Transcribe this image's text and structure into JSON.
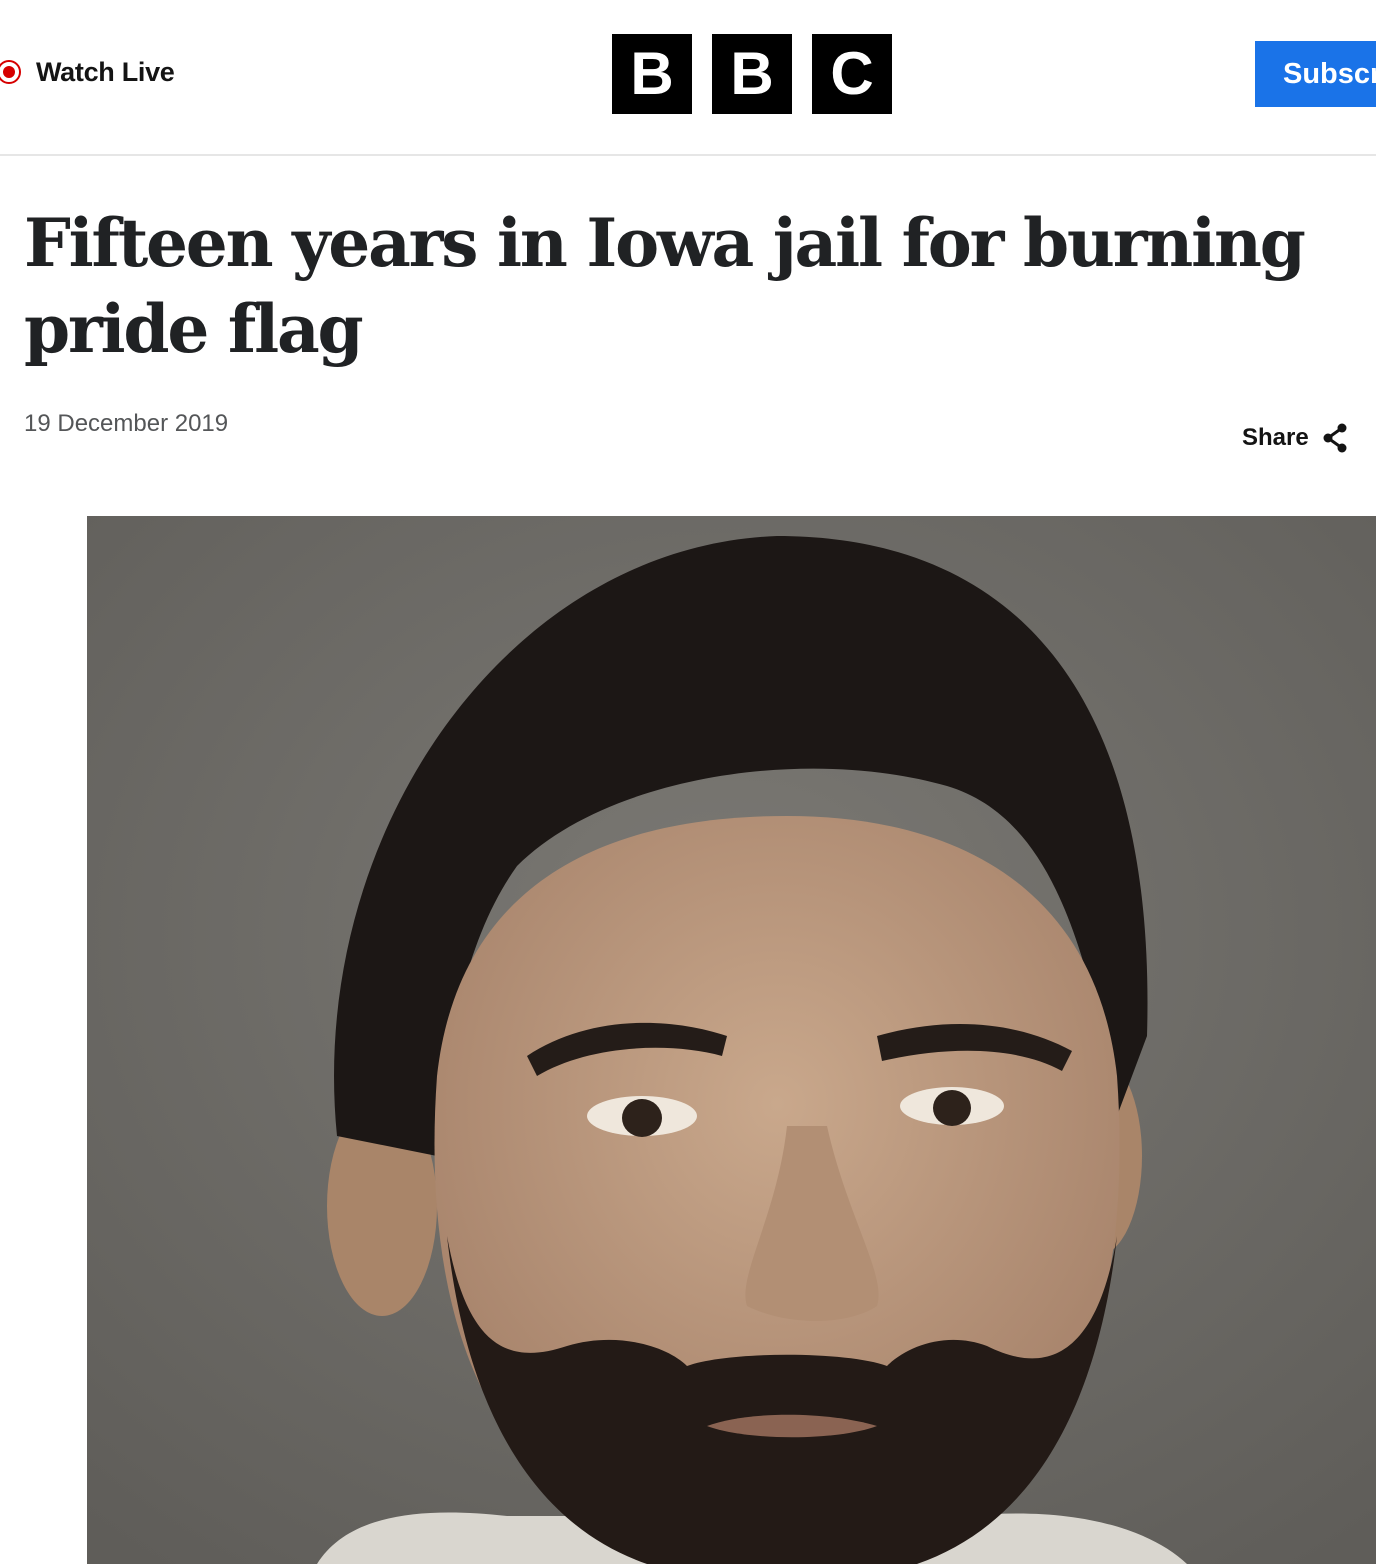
{
  "header": {
    "watch_live_label": "Watch Live",
    "logo_letters": [
      "B",
      "B",
      "C"
    ],
    "subscribe_label": "Subscr"
  },
  "article": {
    "headline": "Fifteen years in Iowa jail for burning pride flag",
    "date": "19 December 2019",
    "share_label": "Share"
  },
  "colors": {
    "live_red": "#d60000",
    "subscribe_blue": "#1a73e8",
    "headline_text": "#202224",
    "date_text": "#545658"
  },
  "icons": {
    "live": "live-indicator-icon",
    "share": "share-icon"
  }
}
